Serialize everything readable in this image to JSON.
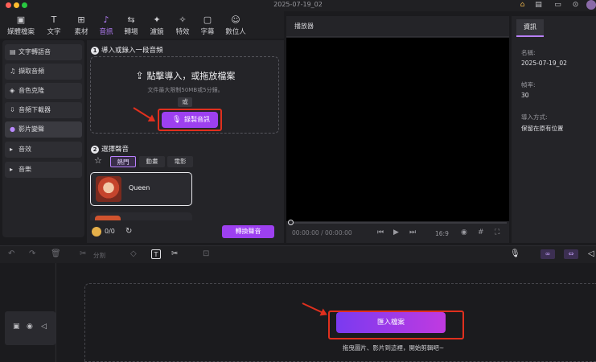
{
  "window": {
    "title": "2025-07-19_02"
  },
  "toolbar": {
    "items": [
      {
        "label": "媒體檔案",
        "icon": "media-icon"
      },
      {
        "label": "文字",
        "icon": "text-icon"
      },
      {
        "label": "素材",
        "icon": "elements-icon"
      },
      {
        "label": "音訊",
        "icon": "audio-note-icon"
      },
      {
        "label": "轉場",
        "icon": "transition-icon"
      },
      {
        "label": "濾鏡",
        "icon": "filter-icon"
      },
      {
        "label": "特效",
        "icon": "effects-icon"
      },
      {
        "label": "字幕",
        "icon": "subtitle-icon"
      },
      {
        "label": "數位人",
        "icon": "avatar-person-icon"
      }
    ],
    "active": "音訊"
  },
  "sidebar": {
    "items": [
      {
        "label": "文字轉語音",
        "icon": "tts-icon"
      },
      {
        "label": "擷取音頻",
        "icon": "extract-audio-icon"
      },
      {
        "label": "音色克隆",
        "icon": "voice-clone-icon"
      },
      {
        "label": "音頻下載器",
        "icon": "download-icon"
      },
      {
        "label": "影片變聲",
        "icon": "voice-changer-icon"
      },
      {
        "label": "音效",
        "icon": "caret-right-icon"
      },
      {
        "label": "音樂",
        "icon": "caret-right-icon"
      }
    ],
    "active": "影片變聲"
  },
  "audio_panel": {
    "step1": "導入或錄入一段音頻",
    "drop_title": "點擊導入，或拖放檔案",
    "drop_sub": "文件最大限制50MB或5分鐘。",
    "or": "或",
    "record_label": "錄製音訊",
    "step2": "選擇聲音",
    "tabs": [
      "熱門",
      "動畫",
      "電影"
    ],
    "voice_name": "Queen",
    "credit": "0/0",
    "convert_label": "轉換聲音"
  },
  "player": {
    "title": "播放器",
    "time": "00:00:00 / 00:00:00",
    "ratio": "16:9"
  },
  "info": {
    "tab": "資訊",
    "name_label": "名稱:",
    "name_value": "2025-07-19_02",
    "fps_label": "幀率:",
    "fps_value": "30",
    "import_label": "導入方式:",
    "import_value": "保留在原有位置"
  },
  "timeline": {
    "split_label": "分割",
    "import_label": "匯入檔案",
    "hint": "拖曳圖片、影片到這裡，開始剪輯吧~"
  },
  "colors": {
    "accent": "#9d40f0",
    "highlight": "#e0301e"
  }
}
